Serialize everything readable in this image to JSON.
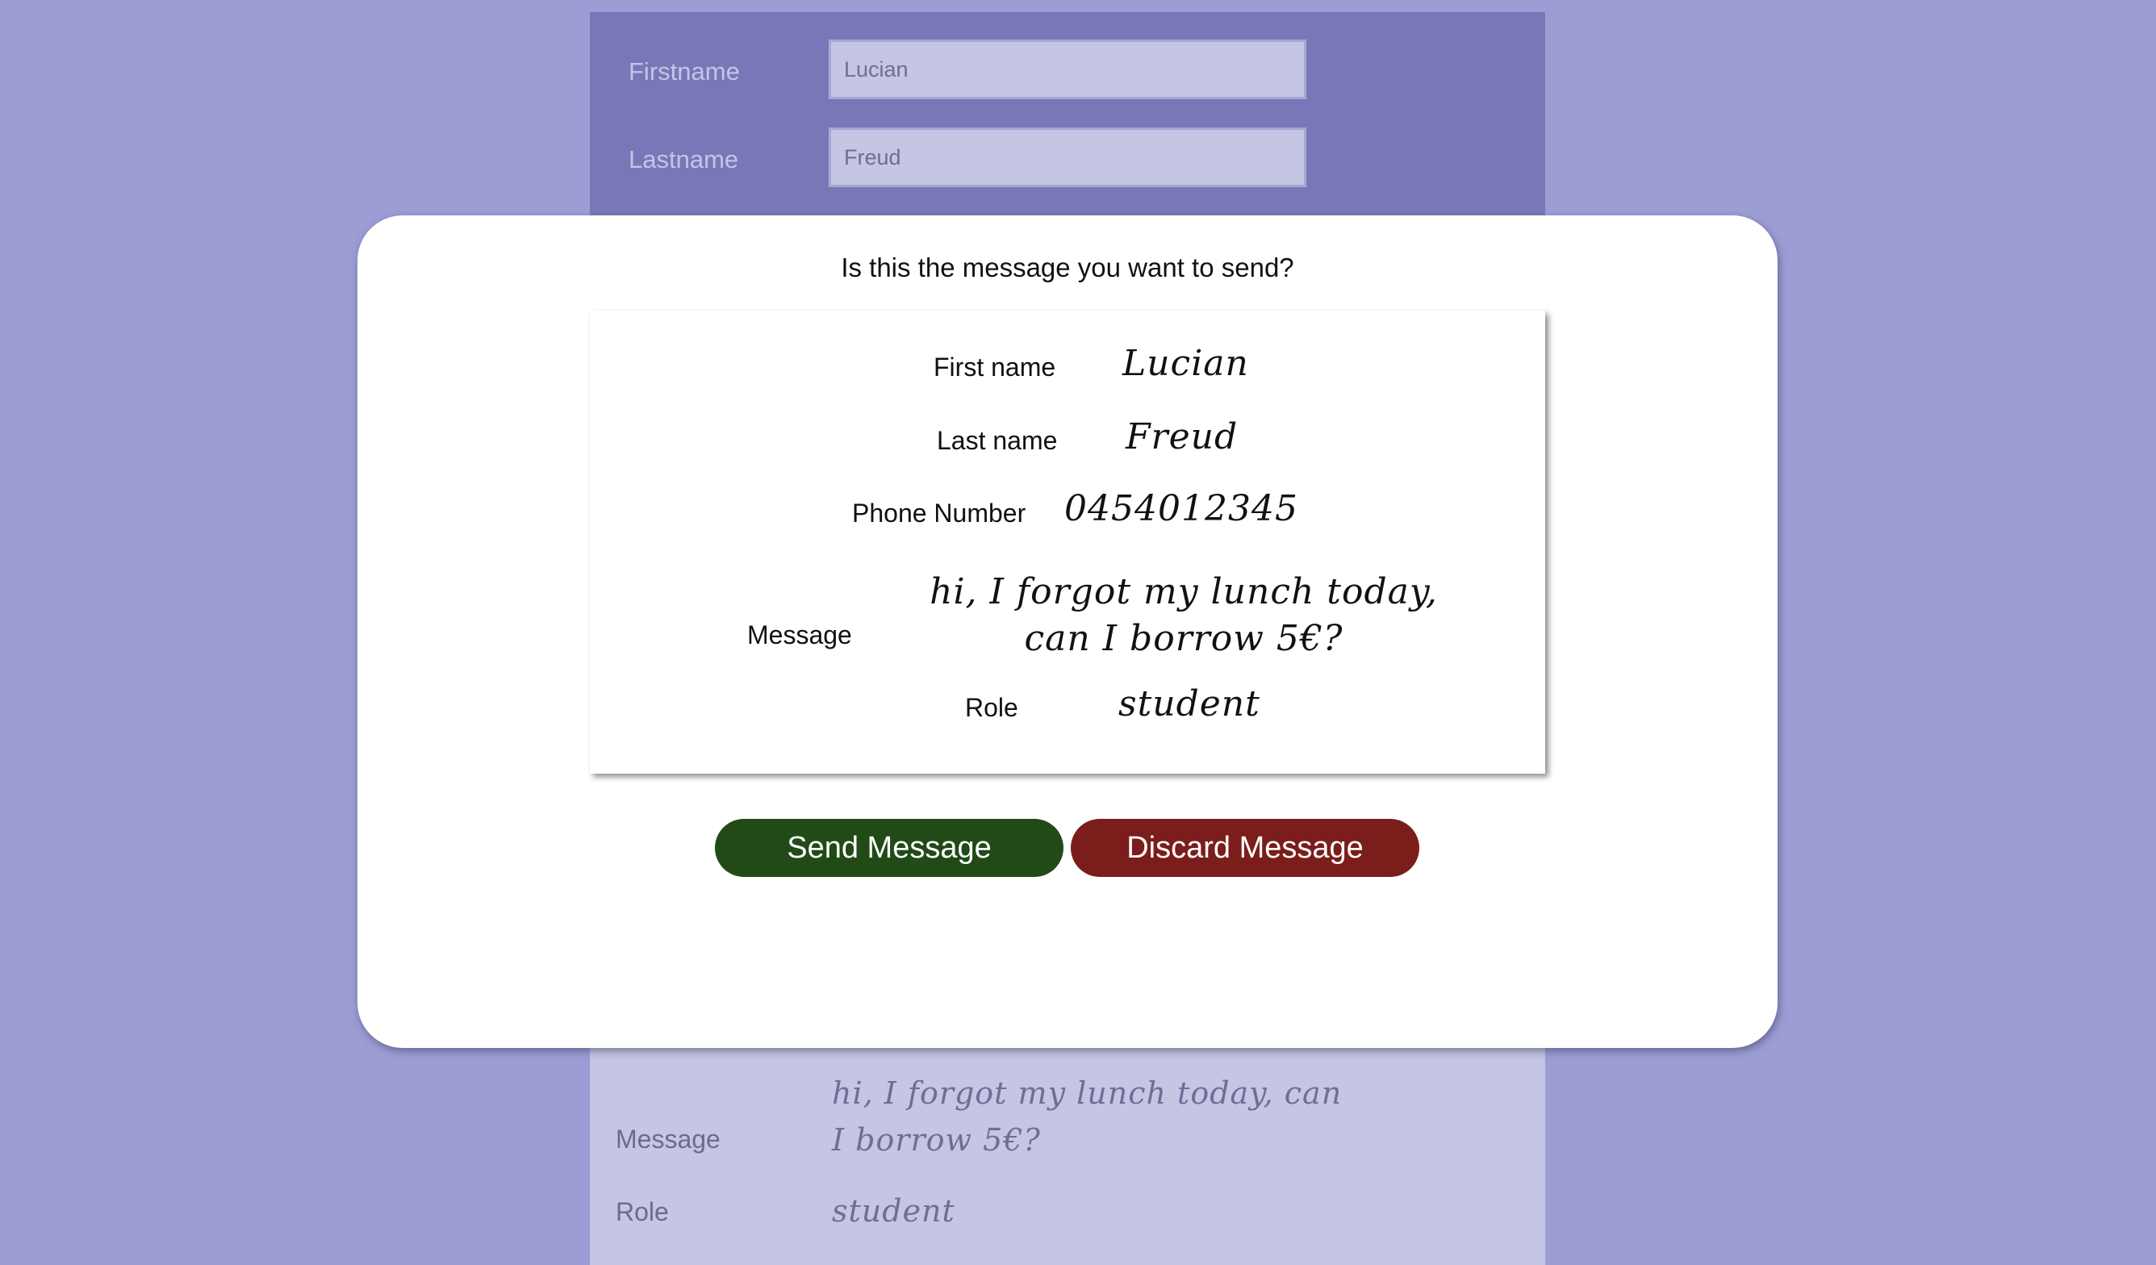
{
  "background_form": {
    "firstname_label": "Firstname",
    "firstname_value": "Lucian",
    "lastname_label": "Lastname",
    "lastname_value": "Freud",
    "message_label": "Message",
    "message_value": "hi, I forgot my lunch today, can I borrow 5€?",
    "role_label": "Role",
    "role_value": "student"
  },
  "modal": {
    "title": "Is this the message you want to send?",
    "fields": {
      "first_name": {
        "label": "First name",
        "value": "Lucian"
      },
      "last_name": {
        "label": "Last name",
        "value": "Freud"
      },
      "phone": {
        "label": "Phone Number",
        "value": "0454012345"
      },
      "message": {
        "label": "Message",
        "value": "hi, I forgot my lunch today, can I borrow 5€?"
      },
      "role": {
        "label": "Role",
        "value": "student"
      }
    },
    "send_label": "Send Message",
    "discard_label": "Discard Message"
  },
  "colors": {
    "page_bg": "#9d9dd6",
    "form_header_bg": "#7878b8",
    "form_body_bg": "#c5c5e4",
    "send_button": "#214a17",
    "discard_button": "#7b1d1b"
  }
}
